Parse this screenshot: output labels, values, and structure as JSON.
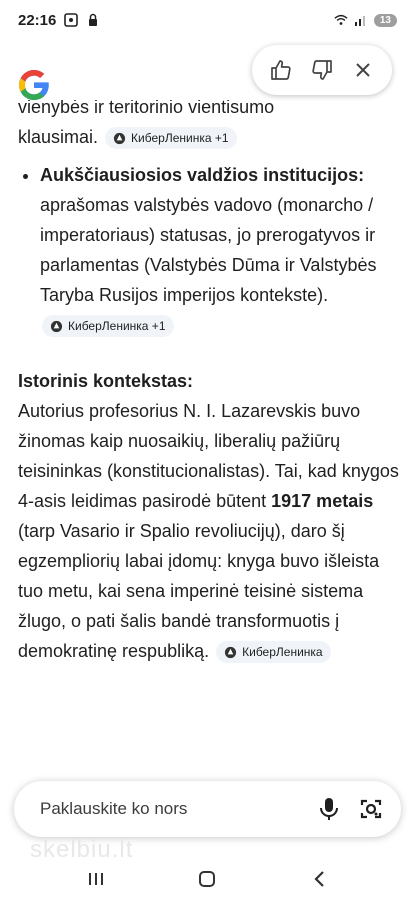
{
  "status_bar": {
    "time": "22:16",
    "battery": "13"
  },
  "feedback": {
    "thumbs_up_icon": "thumbs-up-icon",
    "thumbs_down_icon": "thumbs-down-icon",
    "close_icon": "close-icon"
  },
  "content": {
    "top_partial": "vienybės ir teritorinio vientisumo",
    "top_line": "klausimai.",
    "chip_1": "КиберЛенинка +1",
    "bullet": {
      "bold": "Aukščiausiosios valdžios institucijos:",
      "text": " aprašomas valstybės vadovo (monarcho / imperatoriaus) statusas, jo prerogatyvos ir parlamentas (Valstybės Dūma ir Valstybės Taryba Rusijos imperijos kontekste)."
    },
    "chip_2": "КиберЛенинка +1",
    "section_title": "Istorinis kontekstas:",
    "para_a": "Autorius profesorius N. I. Lazarevskis buvo žinomas kaip nuosaikių, liberalių pažiūrų teisininkas (konstitucionalistas). Tai, kad knygos 4-asis leidimas pasirodė būtent ",
    "para_bold": "1917 metais",
    "para_b": " (tarp Vasario ir Spalio revoliucijų), daro šį egzempliorių labai įdomų: knyga buvo išleista tuo metu, kai sena imperinė teisinė sistema žlugo, o pati šalis bandė transformuotis į demokratinę respubliką.",
    "chip_3": "КиберЛенинка"
  },
  "ask_bar": {
    "placeholder": "Paklauskite ko nors"
  },
  "watermark": "skelbiu.lt",
  "colors": {
    "accent": "#4285f4",
    "chip_bg": "#f0f4f9"
  }
}
